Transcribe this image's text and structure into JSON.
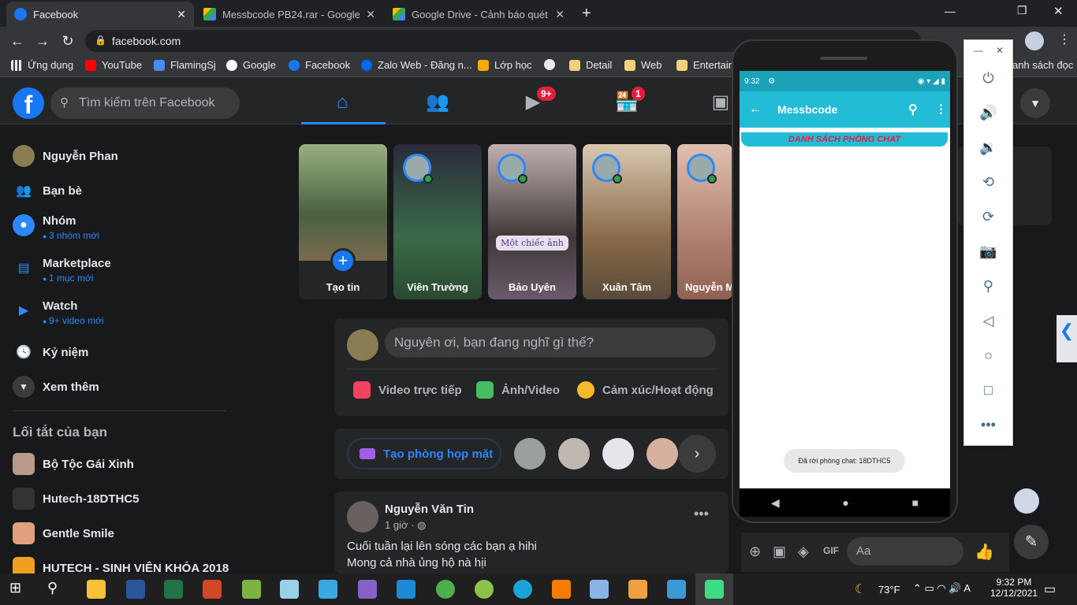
{
  "browser": {
    "tabs": [
      {
        "title": "Facebook",
        "active": true
      },
      {
        "title": "Messbcode PB24.rar - Google Dr",
        "active": false
      },
      {
        "title": "Google Drive - Cảnh báo quét vi",
        "active": false
      }
    ],
    "url": "facebook.com",
    "bookmarks": [
      "Ứng dụng",
      "YouTube",
      "FlamingSj",
      "Google",
      "Facebook",
      "Zalo Web - Đăng n...",
      "Lớp học",
      "Detail",
      "Web",
      "Entertain",
      "anh sách đọc"
    ]
  },
  "fb": {
    "search_placeholder": "Tìm kiếm trên Facebook",
    "badge_watch": "9+",
    "badge_market": "1",
    "sidebar": [
      {
        "label": "Nguyễn Phan",
        "sub": ""
      },
      {
        "label": "Bạn bè",
        "sub": ""
      },
      {
        "label": "Nhóm",
        "sub": "3 nhóm mới"
      },
      {
        "label": "Marketplace",
        "sub": "1 mục mới"
      },
      {
        "label": "Watch",
        "sub": "9+ video mới"
      },
      {
        "label": "Kỷ niệm",
        "sub": ""
      },
      {
        "label": "Xem thêm",
        "sub": ""
      }
    ],
    "shortcuts_title": "Lối tắt của bạn",
    "shortcuts": [
      "Bộ Tộc Gái Xinh",
      "Hutech-18DTHC5",
      "Gentle Smile",
      "HUTECH - SINH VIÊN KHÓA 2018"
    ],
    "stories": [
      "Tạo tin",
      "Viên Trường",
      "Bảo Uyên",
      "Xuân Tâm",
      "Nguyễn M"
    ],
    "story_text_1": "Một chiếc ảnh",
    "composer_placeholder": "Nguyên ơi, bạn đang nghĩ gì thế?",
    "composer_actions": [
      "Video trực tiếp",
      "Ảnh/Video",
      "Cảm xúc/Hoạt động"
    ],
    "room_button": "Tạo phòng họp mặt",
    "post": {
      "author": "Nguyễn Văn Tin",
      "time": "1 giờ ·",
      "line1": "Cuối tuần lại lên sóng các bạn ạ hihi",
      "line2": "Mong cả nhà ủng hộ nà hịi"
    },
    "chat_placeholder": "Aa"
  },
  "phone": {
    "time": "9:32",
    "app_title": "Messbcode",
    "banner": "DANH SÁCH PHÒNG CHAT",
    "toast": "Đã rời phòng chat: 18DTHC5"
  },
  "taskbar": {
    "weather": "73°F",
    "time": "9:32 PM",
    "date": "12/12/2021"
  }
}
